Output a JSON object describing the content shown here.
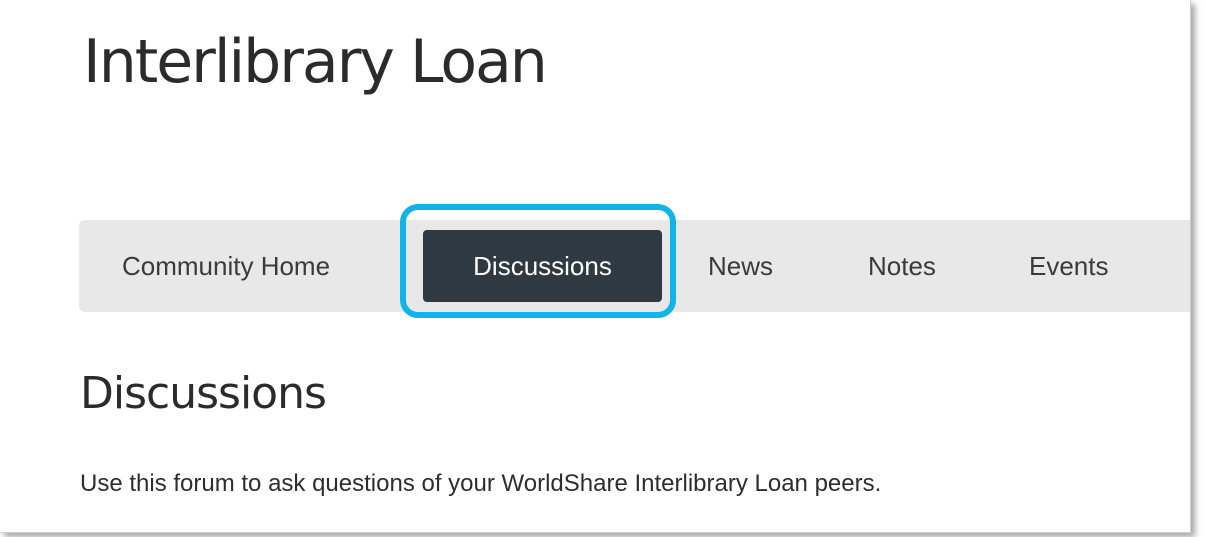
{
  "site": {
    "title": "Interlibrary Loan"
  },
  "nav": {
    "items": [
      {
        "label": "Community Home",
        "active": false
      },
      {
        "label": "Discussions",
        "active": true
      },
      {
        "label": "News",
        "active": false
      },
      {
        "label": "Notes",
        "active": false
      },
      {
        "label": "Events",
        "active": false
      }
    ],
    "highlight_color": "#11b4ea",
    "active_background": "#2f3941",
    "bar_background": "#e8e8e8"
  },
  "section": {
    "heading": "Discussions",
    "description": "Use this forum to ask questions of your WorldShare Interlibrary Loan peers."
  }
}
